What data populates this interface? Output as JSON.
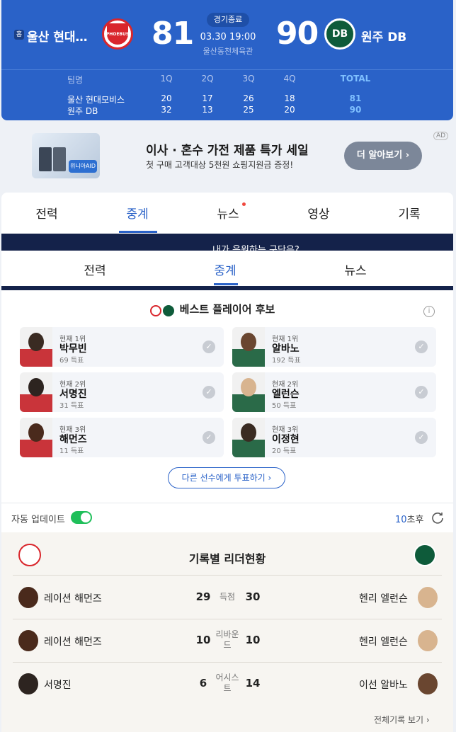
{
  "scoreboard": {
    "home_badge": "홈",
    "home_team": "울산 현대모비스",
    "home_logo_text": "PHOEBUS",
    "home_score": "81",
    "status": "경기종료",
    "datetime": "03.30 19:00",
    "venue": "울산동천체육관",
    "away_score": "90",
    "away_team": "원주 DB",
    "away_logo_text": "DB",
    "quarter_headers": [
      "팀명",
      "1Q",
      "2Q",
      "3Q",
      "4Q",
      "TOTAL"
    ],
    "rows": [
      {
        "team": "울산 현대모비스",
        "q1": "20",
        "q2": "17",
        "q3": "26",
        "q4": "18",
        "total": "81"
      },
      {
        "team": "원주 DB",
        "q1": "32",
        "q2": "13",
        "q3": "25",
        "q4": "20",
        "total": "90"
      }
    ],
    "colors": {
      "bg": "#2a62c8",
      "home": "#d9262c",
      "away": "#0e5b3a"
    }
  },
  "ad": {
    "title": "이사 · 혼수 가전 제품 특가 세일",
    "subtitle": "첫 구매 고객대상 5천원 쇼핑지원금 증정!",
    "cta": "더 알아보기 ›",
    "tag": "AD",
    "image_chip": "위니아AID"
  },
  "tabs_main": [
    "전력",
    "중계",
    "뉴스",
    "영상",
    "기록"
  ],
  "banner_text": "내가 응원하는 구단은?",
  "tabs_sub": [
    "전력",
    "중계",
    "뉴스"
  ],
  "best_player": {
    "title": "베스트 플레이어 후보",
    "home": [
      {
        "rank": "현재 1위",
        "name": "박무빈",
        "votes": "69 득표"
      },
      {
        "rank": "현재 2위",
        "name": "서명진",
        "votes": "31 득표"
      },
      {
        "rank": "현재 3위",
        "name": "해먼즈",
        "votes": "11 득표"
      }
    ],
    "away": [
      {
        "rank": "현재 1위",
        "name": "알바노",
        "votes": "192 득표"
      },
      {
        "rank": "현재 2위",
        "name": "엘런슨",
        "votes": "50 득표"
      },
      {
        "rank": "현재 3위",
        "name": "이정현",
        "votes": "20 득표"
      }
    ],
    "vote_button": "다른 선수에게 투표하기 ›"
  },
  "auto_update": {
    "label": "자동 업데이트",
    "enabled": true,
    "countdown_value": "10",
    "countdown_unit": "초후"
  },
  "leaders": {
    "title": "기록별 리더현황",
    "rows": [
      {
        "home_player": "레이션 해먼즈",
        "home_value": "29",
        "category": "득점",
        "away_value": "30",
        "away_player": "헨리 엘런슨"
      },
      {
        "home_player": "레이션 해먼즈",
        "home_value": "10",
        "category": "리바운드",
        "away_value": "10",
        "away_player": "헨리 엘런슨"
      },
      {
        "home_player": "서명진",
        "home_value": "6",
        "category": "어시스트",
        "away_value": "14",
        "away_player": "이선 알바노"
      }
    ],
    "more_link": "전체기록 보기 ›"
  }
}
